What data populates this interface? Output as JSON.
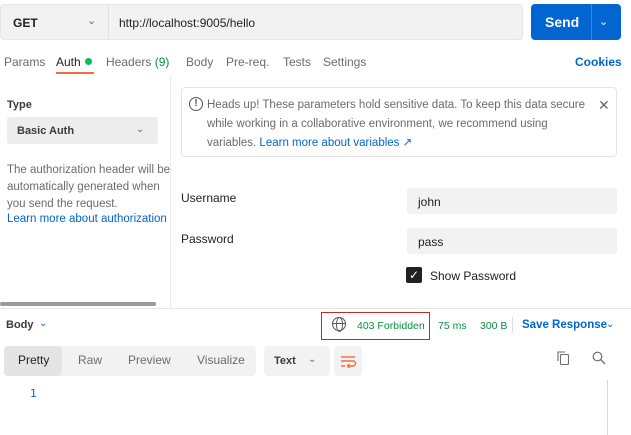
{
  "request": {
    "method": "GET",
    "url": "http://localhost:9005/hello",
    "send_label": "Send"
  },
  "tabs": {
    "params": "Params",
    "auth": "Auth",
    "headers": "Headers",
    "headers_count": "(9)",
    "body": "Body",
    "prereq": "Pre-req.",
    "tests": "Tests",
    "settings": "Settings",
    "cookies": "Cookies"
  },
  "auth": {
    "type_label": "Type",
    "type_value": "Basic Auth",
    "description": "The authorization header will be automatically generated when you send the request.",
    "learn_link": "Learn more about authorization",
    "warning_text": "Heads up! These parameters hold sensitive data. To keep this data secure while working in a collaborative environment, we recommend using variables.",
    "warning_link": "Learn more about variables ↗",
    "username_label": "Username",
    "username_value": "john",
    "password_label": "Password",
    "password_value": "pass",
    "show_password_label": "Show Password",
    "show_password_checked": true
  },
  "response": {
    "body_label": "Body",
    "status": "403 Forbidden",
    "time": "75 ms",
    "size": "300 B",
    "save_label": "Save Response",
    "views": [
      "Pretty",
      "Raw",
      "Preview",
      "Visualize"
    ],
    "active_view": "Pretty",
    "format": "Text",
    "line_number": "1"
  },
  "colors": {
    "accent": "#0265d2",
    "status_green": "#0a8f3e",
    "tab_indicator": "#f26b3a",
    "highlight_box": "#c62828"
  }
}
